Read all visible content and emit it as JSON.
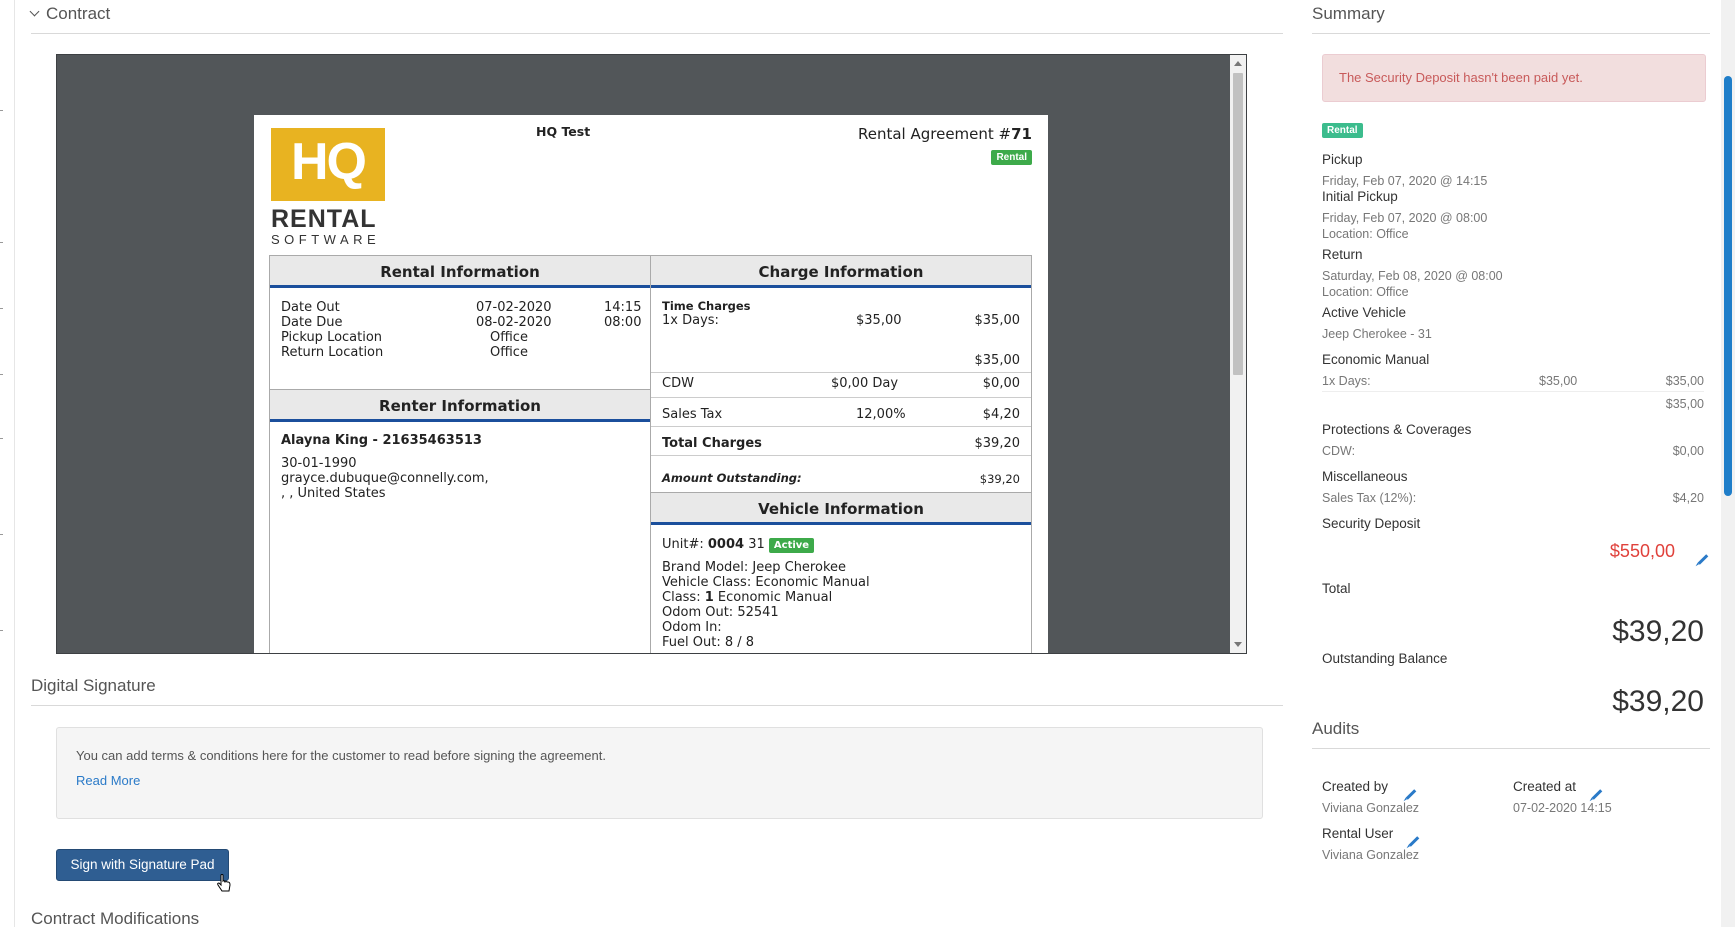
{
  "contract": {
    "title": "Contract"
  },
  "document": {
    "company": "HQ Test",
    "agreement_label": "Rental Agreement #",
    "agreement_number": "71",
    "type_badge": "Rental",
    "logo": {
      "hq": "HQ",
      "rental": "RENTAL",
      "software": "SOFTWARE"
    },
    "rental_info": {
      "header": "Rental Information",
      "rows": [
        {
          "label": "Date Out",
          "date": "07-02-2020",
          "time": "14:15"
        },
        {
          "label": "Date Due",
          "date": "08-02-2020",
          "time": "08:00"
        },
        {
          "label": "Pickup Location",
          "date": "Office",
          "time": ""
        },
        {
          "label": "Return Location",
          "date": "Office",
          "time": ""
        }
      ]
    },
    "renter_info": {
      "header": "Renter Information",
      "name": "Alayna King - 21635463513",
      "dob": "30-01-1990",
      "email": "grayce.dubuque@connelly.com,",
      "address": ", , United States"
    },
    "charge_info": {
      "header": "Charge Information",
      "time_charges": "Time Charges",
      "days_label": "1x Days:",
      "days_rate": "$35,00",
      "days_total": "$35,00",
      "subtotal": "$35,00",
      "cdw_label": "CDW",
      "cdw_rate": "$0,00 Day",
      "cdw_total": "$0,00",
      "tax_label": "Sales Tax",
      "tax_rate": "12,00%",
      "tax_total": "$4,20",
      "total_label": "Total Charges",
      "total_value": "$39,20",
      "outstanding_label": "Amount Outstanding:",
      "outstanding_value": "$39,20"
    },
    "vehicle_info": {
      "header": "Vehicle Information",
      "unit_label": "Unit#:",
      "unit_number": "0004",
      "unit_suffix": "31",
      "status": "Active",
      "brand": "Brand Model: Jeep Cherokee",
      "vclass": "Vehicle Class: Economic Manual",
      "class_label": "Class:",
      "class_num": "1",
      "class_name": "Economic Manual",
      "odom_out": "Odom Out: 52541",
      "odom_in": "Odom In:",
      "fuel_out": "Fuel Out: 8 / 8"
    }
  },
  "signature": {
    "title": "Digital Signature",
    "terms_text": "You can add terms & conditions here for the customer to read before signing the agreement.",
    "read_more": "Read More",
    "sign_button": "Sign with Signature Pad"
  },
  "modifications": {
    "title": "Contract Modifications"
  },
  "summary": {
    "title": "Summary",
    "alert": "The Security Deposit hasn't been paid yet.",
    "badge": "Rental",
    "pickup_label": "Pickup",
    "pickup_value": "Friday, Feb 07, 2020 @ 14:15",
    "initial_pickup_label": "Initial Pickup",
    "initial_pickup_value": "Friday, Feb 07, 2020 @ 08:00",
    "initial_pickup_location": "Location: Office",
    "return_label": "Return",
    "return_value": "Saturday, Feb 08, 2020 @ 08:00",
    "return_location": "Location: Office",
    "active_vehicle_label": "Active Vehicle",
    "active_vehicle_value": "Jeep Cherokee - 31",
    "class_label": "Economic Manual",
    "days_label": "1x Days:",
    "days_rate": "$35,00",
    "days_total": "$35,00",
    "class_subtotal": "$35,00",
    "protections_label": "Protections & Coverages",
    "cdw_label": "CDW:",
    "cdw_value": "$0,00",
    "misc_label": "Miscellaneous",
    "tax_label": "Sales Tax (12%):",
    "tax_value": "$4,20",
    "deposit_label": "Security Deposit",
    "deposit_value": "$550,00",
    "total_label": "Total",
    "total_value": "$39,20",
    "outstanding_label": "Outstanding Balance",
    "outstanding_value": "$39,20",
    "colors": {
      "deposit": "#e0413b",
      "alert_bg": "#f2dede",
      "accent": "#2a7ac8",
      "badge": "#3cbc8d"
    }
  },
  "audits": {
    "title": "Audits",
    "created_by_label": "Created by",
    "created_by_value": "Viviana Gonzalez",
    "created_at_label": "Created at",
    "created_at_value": "07-02-2020 14:15",
    "rental_user_label": "Rental User",
    "rental_user_value": "Viviana Gonzalez"
  }
}
